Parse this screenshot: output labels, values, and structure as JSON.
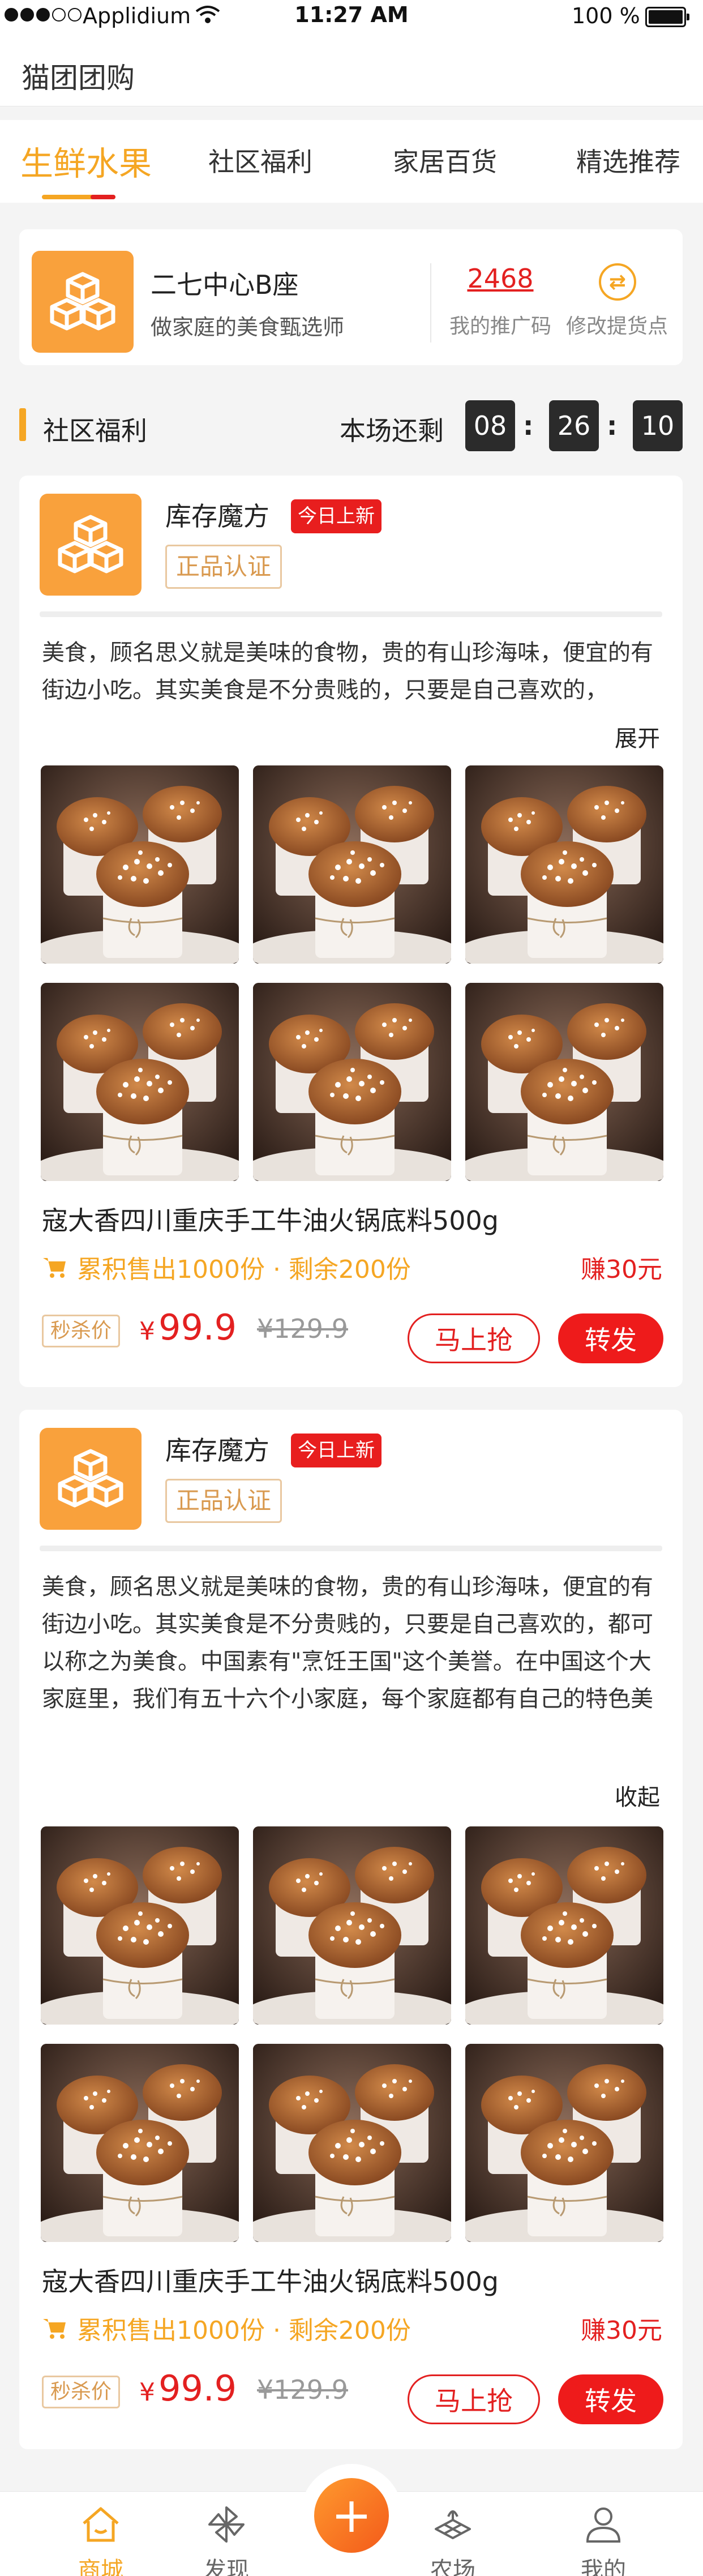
{
  "status_bar": {
    "carrier": "Applidium",
    "time": "11:27 AM",
    "battery": "100 %"
  },
  "app": {
    "title": "猫团团购"
  },
  "tabs": [
    {
      "label": "生鲜水果",
      "active": true
    },
    {
      "label": "社区福利",
      "active": false
    },
    {
      "label": "家居百货",
      "active": false
    },
    {
      "label": "精选推荐",
      "active": false
    }
  ],
  "store": {
    "name": "二七中心B座",
    "slogan": "做家庭的美食甄选师",
    "promo_code": "2468",
    "promo_code_label": "我的推广码",
    "change_pickup_label": "修改提货点"
  },
  "section": {
    "title": "社区福利",
    "countdown_label": "本场还剩",
    "countdown": {
      "hours": "08",
      "minutes": "26",
      "seconds": "10"
    }
  },
  "products": [
    {
      "shop": "库存魔方",
      "new_badge": "今日上新",
      "auth_label": "正品认证",
      "description": "美食，顾名思义就是美味的食物，贵的有山珍海味，便宜的有街边小吃。其实美食是不分贵贱的，只要是自己喜欢的，",
      "toggle_label": "展开",
      "name": "寇大香四川重庆手工牛油火锅底料500g",
      "sold_text": "累积售出1000份 · 剩余200份",
      "earn": "赚30元",
      "flash_label": "秒杀价",
      "price_symbol": "¥",
      "price": "99.9",
      "original_price": "¥129.9",
      "buy_label": "马上抢",
      "share_label": "转发"
    },
    {
      "shop": "库存魔方",
      "new_badge": "今日上新",
      "auth_label": "正品认证",
      "description": "美食，顾名思义就是美味的食物，贵的有山珍海味，便宜的有街边小吃。其实美食是不分贵贱的，只要是自己喜欢的，都可以称之为美食。中国素有\"烹饪王国\"这个美誉。在中国这个大家庭里，我们有五十六个小家庭，每个家庭都有自己的特色美食。",
      "toggle_label": "收起",
      "name": "寇大香四川重庆手工牛油火锅底料500g",
      "sold_text": "累积售出1000份 · 剩余200份",
      "earn": "赚30元",
      "flash_label": "秒杀价",
      "price_symbol": "¥",
      "price": "99.9",
      "original_price": "¥129.9",
      "buy_label": "马上抢",
      "share_label": "转发"
    }
  ],
  "bottom_nav": [
    {
      "label": "商城",
      "icon": "home-icon",
      "active": true
    },
    {
      "label": "发现",
      "icon": "pinwheel-icon",
      "active": false
    },
    {
      "label": "",
      "icon": "plus-icon",
      "active": false
    },
    {
      "label": "农场",
      "icon": "farm-icon",
      "active": false
    },
    {
      "label": "我的",
      "icon": "user-icon",
      "active": false
    }
  ],
  "colors": {
    "accent": "#f5a623",
    "red": "#e32020"
  }
}
